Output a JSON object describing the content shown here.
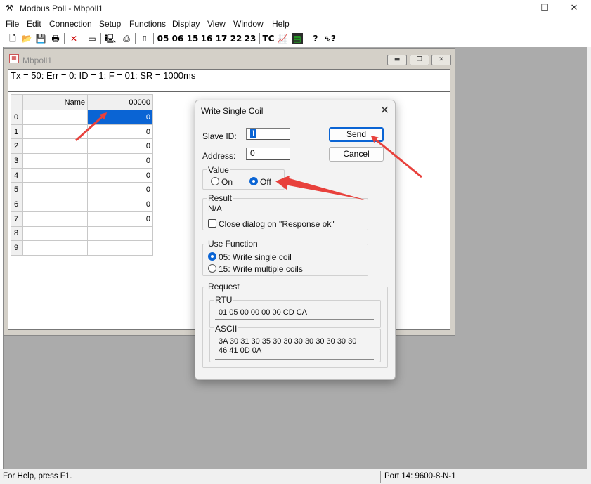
{
  "app": {
    "title": "Modbus Poll - Mbpoll1",
    "icon": "modbus-poll-app-icon"
  },
  "window_controls": {
    "minimize": "—",
    "maximize": "☐",
    "close": "✕"
  },
  "menu": [
    "File",
    "Edit",
    "Connection",
    "Setup",
    "Functions",
    "Display",
    "View",
    "Window",
    "Help"
  ],
  "toolbar": {
    "function_codes": [
      "05",
      "06",
      "15",
      "16",
      "17",
      "22",
      "23"
    ],
    "tc_label": "TC",
    "icons": [
      "new-icon",
      "open-icon",
      "save-icon",
      "print-icon",
      "delete-icon",
      "window-icon",
      "connect-icon",
      "disconnect-icon",
      "pulse-icon",
      "graph-icon",
      "monitor-icon",
      "help-icon",
      "context-help-icon"
    ]
  },
  "child_window": {
    "title": "Mbpoll1",
    "status": "Tx = 50: Err = 0: ID = 1: F = 01: SR = 1000ms",
    "grid": {
      "headers": [
        "Name",
        "00000"
      ],
      "rows": [
        {
          "index": "0",
          "name": "",
          "value": "0"
        },
        {
          "index": "1",
          "name": "",
          "value": "0"
        },
        {
          "index": "2",
          "name": "",
          "value": "0"
        },
        {
          "index": "3",
          "name": "",
          "value": "0"
        },
        {
          "index": "4",
          "name": "",
          "value": "0"
        },
        {
          "index": "5",
          "name": "",
          "value": "0"
        },
        {
          "index": "6",
          "name": "",
          "value": "0"
        },
        {
          "index": "7",
          "name": "",
          "value": "0"
        },
        {
          "index": "8",
          "name": "",
          "value": ""
        },
        {
          "index": "9",
          "name": "",
          "value": ""
        }
      ]
    }
  },
  "dialog": {
    "title": "Write Single Coil",
    "slave_id_label": "Slave ID:",
    "slave_id_value": "1",
    "address_label": "Address:",
    "address_value": "0",
    "send_label": "Send",
    "cancel_label": "Cancel",
    "value_group": "Value",
    "on_label": "On",
    "off_label": "Off",
    "value_selected": "Off",
    "result_group": "Result",
    "result_value": "N/A",
    "close_on_ok_label": "Close dialog on \"Response ok\"",
    "close_on_ok_checked": false,
    "use_function_group": "Use Function",
    "func_05_label": "05: Write single coil",
    "func_15_label": "15: Write multiple coils",
    "function_selected": "05",
    "request_group": "Request",
    "rtu_label": "RTU",
    "rtu_value": "01 05 00 00 00 00 CD CA",
    "ascii_label": "ASCII",
    "ascii_line1": "3A 30 31 30 35 30 30 30 30 30 30 30 30",
    "ascii_line2": "46 41 0D 0A"
  },
  "statusbar": {
    "help": "For Help, press F1.",
    "port": "Port 14: 9600-8-N-1"
  },
  "colors": {
    "selection": "#0a64d4",
    "annotation_arrow": "#e8413c",
    "mdi_background": "#ababab"
  }
}
